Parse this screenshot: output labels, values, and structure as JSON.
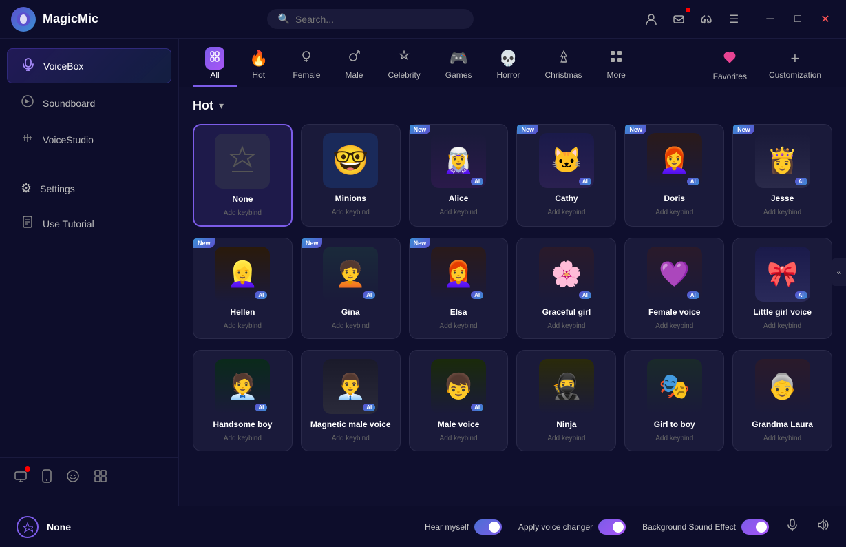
{
  "app": {
    "title": "MagicMic",
    "logo": "🎙"
  },
  "titlebar": {
    "search_placeholder": "Search...",
    "icons": [
      "👤",
      "✉",
      "🎮",
      "☰"
    ],
    "window_controls": [
      "─",
      "□",
      "✕"
    ]
  },
  "sidebar": {
    "items": [
      {
        "id": "voicebox",
        "label": "VoiceBox",
        "icon": "🎤",
        "active": true
      },
      {
        "id": "soundboard",
        "label": "Soundboard",
        "icon": "🎵",
        "active": false
      },
      {
        "id": "voicestudio",
        "label": "VoiceStudio",
        "icon": "🎛",
        "active": false
      }
    ],
    "middle_items": [
      {
        "id": "settings",
        "label": "Settings",
        "icon": "⚙",
        "active": false
      },
      {
        "id": "tutorial",
        "label": "Use Tutorial",
        "icon": "📖",
        "active": false
      }
    ],
    "bottom_icons": [
      {
        "id": "screen",
        "icon": "⊞",
        "badge": true
      },
      {
        "id": "phone",
        "icon": "📱",
        "badge": false
      },
      {
        "id": "chat",
        "icon": "💬",
        "badge": false
      },
      {
        "id": "layout",
        "icon": "⊟",
        "badge": false
      }
    ]
  },
  "categories": [
    {
      "id": "all",
      "label": "All",
      "icon": "🎙",
      "active": true
    },
    {
      "id": "hot",
      "label": "Hot",
      "icon": "🔥",
      "active": false
    },
    {
      "id": "female",
      "label": "Female",
      "icon": "♀",
      "active": false
    },
    {
      "id": "male",
      "label": "Male",
      "icon": "♂",
      "active": false
    },
    {
      "id": "celebrity",
      "label": "Celebrity",
      "icon": "🎭",
      "active": false
    },
    {
      "id": "games",
      "label": "Games",
      "icon": "🎮",
      "active": false
    },
    {
      "id": "horror",
      "label": "Horror",
      "icon": "💀",
      "active": false
    },
    {
      "id": "christmas",
      "label": "Christmas",
      "icon": "🎄",
      "active": false
    },
    {
      "id": "more",
      "label": "More",
      "icon": "⋯",
      "active": false
    }
  ],
  "extras": [
    {
      "id": "favorites",
      "label": "Favorites",
      "icon": "♥"
    },
    {
      "id": "customization",
      "label": "Customization",
      "icon": "+"
    }
  ],
  "section": {
    "title": "Hot",
    "dropdown_icon": "▾"
  },
  "voices_row1": [
    {
      "id": "none",
      "name": "None",
      "keybind": "Add keybind",
      "avatar": "☆",
      "selected": true,
      "badge": "",
      "ai": false,
      "avatar_type": "none"
    },
    {
      "id": "minions",
      "name": "Minions",
      "keybind": "Add keybind",
      "avatar": "👓",
      "selected": false,
      "badge": "",
      "ai": false,
      "avatar_type": "minions"
    },
    {
      "id": "alice",
      "name": "Alice",
      "keybind": "Add keybind",
      "avatar": "🧝",
      "selected": false,
      "badge": "New",
      "ai": true,
      "avatar_type": "alice"
    },
    {
      "id": "cathy",
      "name": "Cathy",
      "keybind": "Add keybind",
      "avatar": "🐱",
      "selected": false,
      "badge": "New",
      "ai": true,
      "avatar_type": "cathy"
    },
    {
      "id": "doris",
      "name": "Doris",
      "keybind": "Add keybind",
      "avatar": "👩‍🦰",
      "selected": false,
      "badge": "New",
      "ai": true,
      "avatar_type": "doris"
    },
    {
      "id": "jesse",
      "name": "Jesse",
      "keybind": "Add keybind",
      "avatar": "👸",
      "selected": false,
      "badge": "New",
      "ai": true,
      "avatar_type": "jesse"
    }
  ],
  "voices_row2": [
    {
      "id": "hellen",
      "name": "Hellen",
      "keybind": "Add keybind",
      "avatar": "👱‍♀️",
      "selected": false,
      "badge": "New",
      "ai": true,
      "avatar_type": "hellen"
    },
    {
      "id": "gina",
      "name": "Gina",
      "keybind": "Add keybind",
      "avatar": "🧑‍🦱",
      "selected": false,
      "badge": "New",
      "ai": true,
      "avatar_type": "gina"
    },
    {
      "id": "elsa",
      "name": "Elsa",
      "keybind": "Add keybind",
      "avatar": "👩‍🦰",
      "selected": false,
      "badge": "New",
      "ai": true,
      "avatar_type": "elsa"
    },
    {
      "id": "graceful",
      "name": "Graceful girl",
      "keybind": "Add keybind",
      "avatar": "🌸",
      "selected": false,
      "badge": "",
      "ai": true,
      "avatar_type": "graceful"
    },
    {
      "id": "femalevoice",
      "name": "Female voice",
      "keybind": "Add keybind",
      "avatar": "💜",
      "selected": false,
      "badge": "",
      "ai": true,
      "avatar_type": "female"
    },
    {
      "id": "littlegirl",
      "name": "Little girl voice",
      "keybind": "Add keybind",
      "avatar": "🎀",
      "selected": false,
      "badge": "",
      "ai": true,
      "avatar_type": "littlegirl"
    }
  ],
  "voices_row3": [
    {
      "id": "handsome",
      "name": "Handsome boy",
      "keybind": "Add keybind",
      "avatar": "🧑‍💼",
      "selected": false,
      "badge": "",
      "ai": true,
      "avatar_type": "handsome"
    },
    {
      "id": "magnetic",
      "name": "Magnetic male voice",
      "keybind": "Add keybind",
      "avatar": "👨‍💼",
      "selected": false,
      "badge": "",
      "ai": true,
      "avatar_type": "magnetic"
    },
    {
      "id": "malevoice",
      "name": "Male voice",
      "keybind": "Add keybind",
      "avatar": "👦",
      "selected": false,
      "badge": "",
      "ai": true,
      "avatar_type": "malevoice"
    },
    {
      "id": "ninja",
      "name": "Ninja",
      "keybind": "Add keybind",
      "avatar": "🥷",
      "selected": false,
      "badge": "",
      "ai": false,
      "avatar_type": "ninja"
    },
    {
      "id": "girltboy",
      "name": "Girl to boy",
      "keybind": "Add keybind",
      "avatar": "🎭",
      "selected": false,
      "badge": "",
      "ai": false,
      "avatar_type": "girtoboy"
    },
    {
      "id": "grandmalau",
      "name": "Grandma Laura",
      "keybind": "Add keybind",
      "avatar": "👵",
      "selected": false,
      "badge": "",
      "ai": false,
      "avatar_type": "grandma"
    }
  ],
  "statusbar": {
    "star_icon": "☆",
    "current_voice": "None",
    "hear_myself_label": "Hear myself",
    "hear_myself_on": true,
    "apply_voice_changer_label": "Apply voice changer",
    "apply_voice_on": true,
    "bg_sound_label": "Background Sound Effect",
    "bg_sound_on": true,
    "mic_icon": "🎤",
    "volume_icon": "🔊"
  }
}
